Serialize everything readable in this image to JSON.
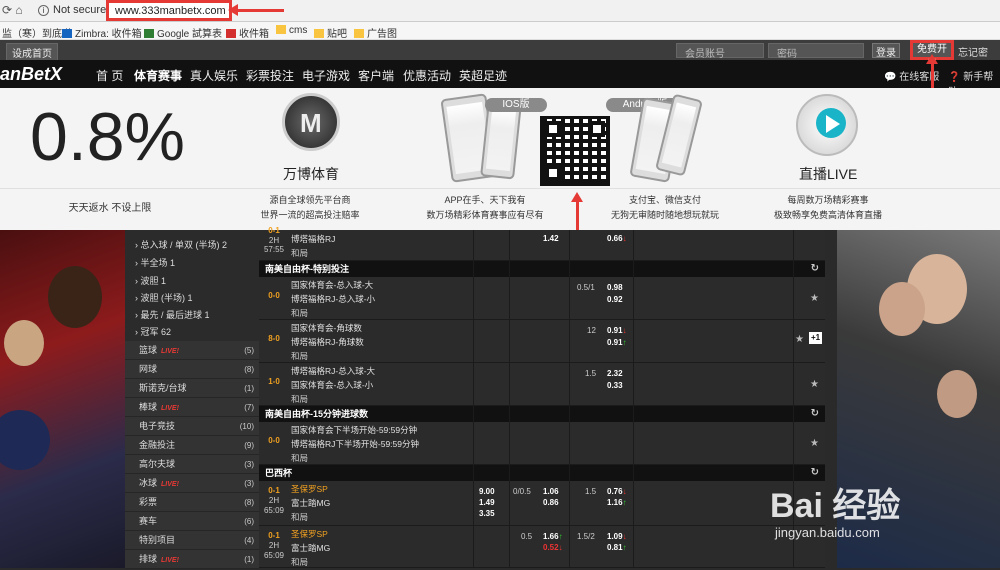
{
  "browser": {
    "security": "Not secure",
    "url": "www.333manbetx.com",
    "bookmarks": [
      "监（寒）到底啦",
      "Zimbra: 收件箱",
      "Google 試算表",
      "收件箱",
      "cms",
      "贴吧",
      "广告图"
    ]
  },
  "topbar": {
    "set_home": "设成首页",
    "account_placeholder": "会员账号",
    "password_placeholder": "密码",
    "login": "登录",
    "register": "免费开户",
    "forgot": "忘记密码？"
  },
  "nav": {
    "logo": "anBetX",
    "items": [
      "首 页",
      "体育赛事",
      "真人娱乐",
      "彩票投注",
      "电子游戏",
      "客户端",
      "优惠活动",
      "英超足迹"
    ],
    "online_service": "在线客服",
    "help": "新手帮助"
  },
  "banner": {
    "rebate": "0.8%",
    "rebate_caption": "天天返水 不设上限",
    "brand_title": "万博体育",
    "brand_caption": [
      "源自全球领先平台商",
      "世界一流的超高投注赔率"
    ],
    "ios_label": "IOS版",
    "android_label": "Android版",
    "app_caption": [
      "APP在手、天下我有",
      "数万场精彩体育赛事应有尽有"
    ],
    "pay_caption": [
      "支付宝、微信支付",
      "无狗无审随时随地想玩就玩"
    ],
    "live_title": "直播LIVE",
    "live_caption": [
      "每周数万场精彩赛事",
      "极致畅享免费高清体育直播"
    ]
  },
  "sidebar": {
    "sub_items": [
      {
        "label": "› 总入球 / 单双 (半场)",
        "count": "2"
      },
      {
        "label": "› 半全场",
        "count": "1"
      },
      {
        "label": "› 波胆",
        "count": "1"
      },
      {
        "label": "› 波胆 (半场)",
        "count": "1"
      },
      {
        "label": "› 最先 / 最后进球",
        "count": "1"
      },
      {
        "label": "› 冠军",
        "count": "62"
      }
    ],
    "sports": [
      {
        "label": "篮球",
        "live": "LIVE!",
        "count": "(5)"
      },
      {
        "label": "网球",
        "live": "",
        "count": "(8)"
      },
      {
        "label": "斯诺克/台球",
        "live": "",
        "count": "(1)"
      },
      {
        "label": "棒球",
        "live": "LIVE!",
        "count": "(7)"
      },
      {
        "label": "电子竞技",
        "live": "",
        "count": "(10)"
      },
      {
        "label": "金融投注",
        "live": "",
        "count": "(9)"
      },
      {
        "label": "高尔夫球",
        "live": "",
        "count": "(3)"
      },
      {
        "label": "冰球",
        "live": "LIVE!",
        "count": "(3)"
      },
      {
        "label": "彩票",
        "live": "",
        "count": "(8)"
      },
      {
        "label": "赛车",
        "live": "",
        "count": "(6)"
      },
      {
        "label": "特别项目",
        "live": "",
        "count": "(4)"
      },
      {
        "label": "排球",
        "live": "LIVE!",
        "count": "(1)"
      }
    ]
  },
  "matches": {
    "top_row": {
      "score": "0-1",
      "time": "2H",
      "clock": "57:55",
      "team1": "博塔福格RJ",
      "draw": "和局",
      "odd_a": "1.42",
      "odd_b": "0.66"
    },
    "league1": "南美自由杯-特别投注",
    "rows1": [
      {
        "score": "0-0",
        "team1": "国家体育会-总入球-大",
        "team2": "博塔福格RJ-总入球-小",
        "draw": "和局",
        "line": "0.5/1",
        "o1": "0.98",
        "o2": "0.92"
      },
      {
        "score": "8-0",
        "team1": "国家体育会-角球数",
        "team2": "博塔福格RJ-角球数",
        "draw": "和局",
        "line": "12",
        "o1": "0.91",
        "o2": "0.91",
        "plus": "+1"
      },
      {
        "score": "1-0",
        "team1": "博塔福格RJ-总入球-大",
        "team2": "国家体育会-总入球-小",
        "draw": "和局",
        "line": "1.5",
        "o1": "2.32",
        "o2": "0.33"
      }
    ],
    "league2": "南美自由杯-15分钟进球数",
    "rows2": [
      {
        "score": "0-0",
        "team1": "国家体育会下半场开始-59:59分钟",
        "team2": "博塔福格RJ下半场开始-59:59分钟",
        "draw": "和局"
      }
    ],
    "league3": "巴西杯",
    "rows3": [
      {
        "score": "0-1",
        "time": "2H",
        "clock": "65:09",
        "team1": "圣保罗SP",
        "team2": "富士踏MG",
        "draw": "和局",
        "x1": "9.00",
        "x2": "1.49",
        "x3": "3.35",
        "h": "0/0.5",
        "h1": "1.06",
        "h2": "0.86",
        "ou": "1.5",
        "ou1": "0.76",
        "ou2": "1.16"
      },
      {
        "score": "0-1",
        "time": "2H",
        "clock": "65:09",
        "team1": "圣保罗SP",
        "team2": "富士踏MG",
        "draw": "和局",
        "h": "0.5",
        "h1": "1.66",
        "h2": "0.52",
        "ou": "1.5/2",
        "ou1": "1.09",
        "ou2": "0.81"
      }
    ]
  },
  "watermark": {
    "text": "Bai 经验",
    "url": "jingyan.baidu.com"
  },
  "colors": {
    "accent_red": "#e53935",
    "score_orange": "#f0a020",
    "odds_up": "#33cc33",
    "odds_down": "#ee3333"
  }
}
